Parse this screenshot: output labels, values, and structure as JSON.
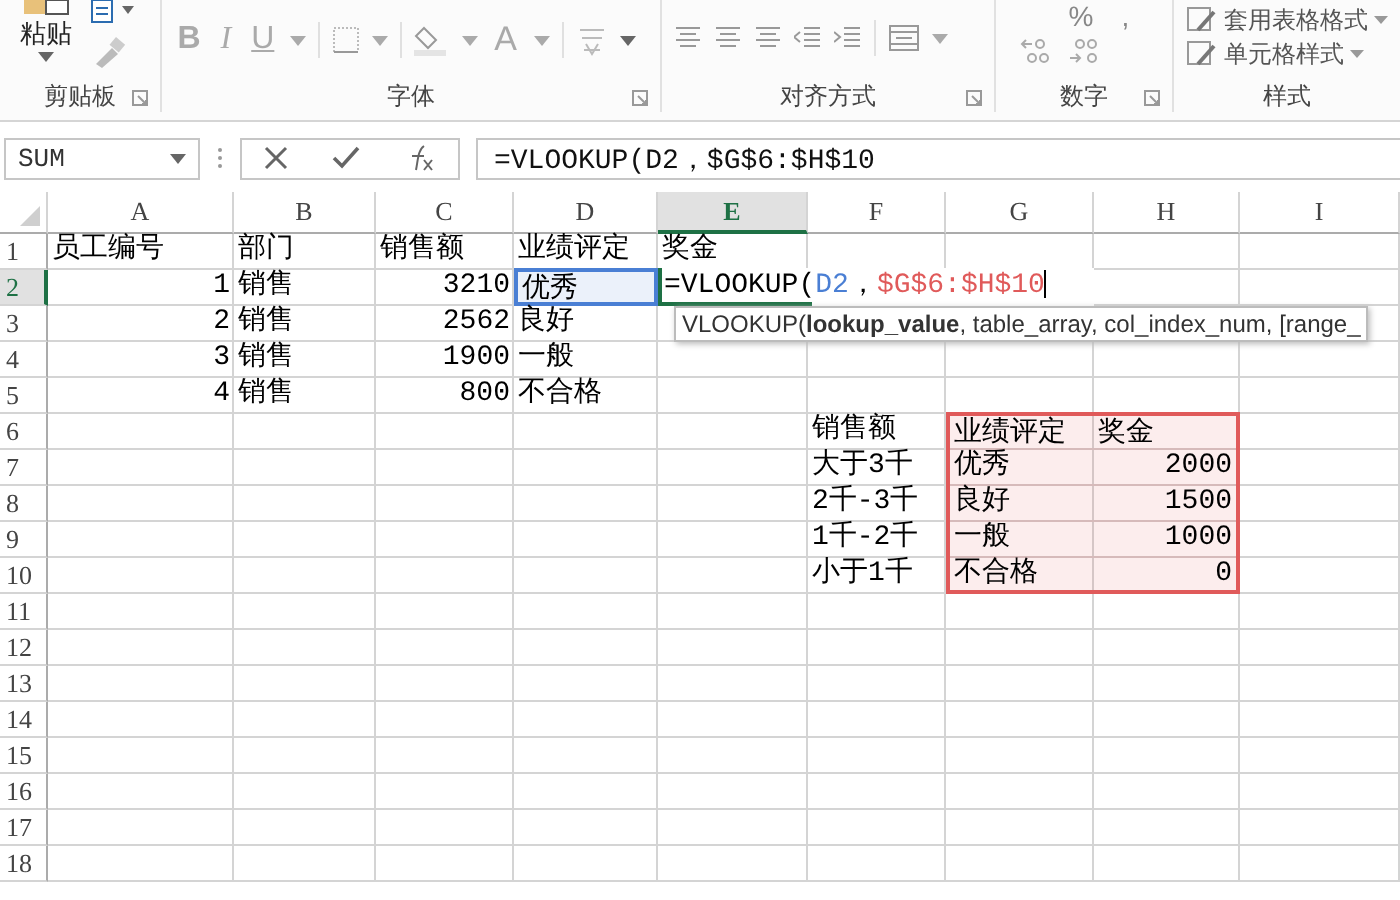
{
  "ribbon": {
    "groups": [
      {
        "kind": "clipboard",
        "label": "剪贴板",
        "launcher": true,
        "paste": "粘贴"
      },
      {
        "kind": "font",
        "label": "字体",
        "launcher": true,
        "buttons": [
          "B",
          "I",
          "U",
          "A"
        ]
      },
      {
        "kind": "alignment",
        "label": "对齐方式",
        "launcher": true
      },
      {
        "kind": "number",
        "label": "数字",
        "launcher": true,
        "buttons": [
          "%",
          ","
        ]
      },
      {
        "kind": "styles",
        "label": "样式",
        "launcher": false,
        "items": [
          "套用表格格式",
          "单元格样式"
        ]
      }
    ]
  },
  "formula_bar": {
    "name_box": "SUM",
    "formula": "=VLOOKUP(D2，$G$6:$H$10"
  },
  "columns": [
    {
      "label": "A",
      "selected": false
    },
    {
      "label": "B",
      "selected": false
    },
    {
      "label": "C",
      "selected": false
    },
    {
      "label": "D",
      "selected": false
    },
    {
      "label": "E",
      "selected": true
    },
    {
      "label": "F",
      "selected": false
    },
    {
      "label": "G",
      "selected": false
    },
    {
      "label": "H",
      "selected": false
    },
    {
      "label": "I",
      "selected": false
    }
  ],
  "rows": [
    {
      "label": "1",
      "selected": false,
      "cells": [
        {
          "kind": "text",
          "text": "员工编号"
        },
        {
          "kind": "text",
          "text": "部门"
        },
        {
          "kind": "text",
          "text": "销售额"
        },
        {
          "kind": "text",
          "text": "业绩评定"
        },
        {
          "kind": "text",
          "text": "奖金"
        }
      ]
    },
    {
      "label": "2",
      "selected": true,
      "cells": [
        {
          "kind": "number",
          "text": "1"
        },
        {
          "kind": "text",
          "text": "销售"
        },
        {
          "kind": "number",
          "text": "3210"
        },
        {
          "kind": "text",
          "text": "优秀",
          "color": "#4a7fd4"
        },
        {
          "kind": "edit",
          "parts": [
            {
              "text": "=VLOOKUP(",
              "color": "#000000"
            },
            {
              "text": "D2",
              "color": "#4a7fd4"
            },
            {
              "text": "，",
              "color": "#000000"
            },
            {
              "text": "$G$6:$H$10",
              "color": "#e05a5a"
            }
          ]
        }
      ]
    },
    {
      "label": "3",
      "selected": false,
      "cells": [
        {
          "kind": "number",
          "text": "2"
        },
        {
          "kind": "text",
          "text": "销售"
        },
        {
          "kind": "number",
          "text": "2562"
        },
        {
          "kind": "text",
          "text": "良好"
        }
      ]
    },
    {
      "label": "4",
      "selected": false,
      "cells": [
        {
          "kind": "number",
          "text": "3"
        },
        {
          "kind": "text",
          "text": "销售"
        },
        {
          "kind": "number",
          "text": "1900"
        },
        {
          "kind": "text",
          "text": "一般"
        }
      ]
    },
    {
      "label": "5",
      "selected": false,
      "cells": [
        {
          "kind": "number",
          "text": "4"
        },
        {
          "kind": "text",
          "text": "销售"
        },
        {
          "kind": "number",
          "text": "800"
        },
        {
          "kind": "text",
          "text": "不合格"
        }
      ]
    },
    {
      "label": "6",
      "selected": false,
      "cells": [
        {
          "kind": "blank"
        },
        {
          "kind": "blank"
        },
        {
          "kind": "blank"
        },
        {
          "kind": "blank"
        },
        {
          "kind": "blank"
        },
        {
          "kind": "text",
          "text": "销售额"
        },
        {
          "kind": "text",
          "text": "业绩评定",
          "color": "#e05a5a"
        },
        {
          "kind": "text",
          "text": "奖金",
          "color": "#e05a5a"
        }
      ]
    },
    {
      "label": "7",
      "selected": false,
      "cells": [
        {
          "kind": "blank"
        },
        {
          "kind": "blank"
        },
        {
          "kind": "blank"
        },
        {
          "kind": "blank"
        },
        {
          "kind": "blank"
        },
        {
          "kind": "text",
          "text": "大于3千"
        },
        {
          "kind": "text",
          "text": "优秀",
          "color": "#e05a5a"
        },
        {
          "kind": "number",
          "text": "2000",
          "color": "#e05a5a"
        }
      ]
    },
    {
      "label": "8",
      "selected": false,
      "cells": [
        {
          "kind": "blank"
        },
        {
          "kind": "blank"
        },
        {
          "kind": "blank"
        },
        {
          "kind": "blank"
        },
        {
          "kind": "blank"
        },
        {
          "kind": "text",
          "text": "2千-3千"
        },
        {
          "kind": "text",
          "text": "良好",
          "color": "#e05a5a"
        },
        {
          "kind": "number",
          "text": "1500",
          "color": "#e05a5a"
        }
      ]
    },
    {
      "label": "9",
      "selected": false,
      "cells": [
        {
          "kind": "blank"
        },
        {
          "kind": "blank"
        },
        {
          "kind": "blank"
        },
        {
          "kind": "blank"
        },
        {
          "kind": "blank"
        },
        {
          "kind": "text",
          "text": "1千-2千"
        },
        {
          "kind": "text",
          "text": "一般",
          "color": "#e05a5a"
        },
        {
          "kind": "number",
          "text": "1000",
          "color": "#e05a5a"
        }
      ]
    },
    {
      "label": "10",
      "selected": false,
      "cells": [
        {
          "kind": "blank"
        },
        {
          "kind": "blank"
        },
        {
          "kind": "blank"
        },
        {
          "kind": "blank"
        },
        {
          "kind": "blank"
        },
        {
          "kind": "text",
          "text": "小于1千"
        },
        {
          "kind": "text",
          "text": "不合格",
          "color": "#e05a5a"
        },
        {
          "kind": "number",
          "text": "0",
          "color": "#e05a5a"
        }
      ]
    },
    {
      "label": "11",
      "selected": false
    },
    {
      "label": "12",
      "selected": false
    },
    {
      "label": "13",
      "selected": false
    },
    {
      "label": "14",
      "selected": false
    },
    {
      "label": "15",
      "selected": false
    },
    {
      "label": "16",
      "selected": false
    },
    {
      "label": "17",
      "selected": false
    },
    {
      "label": "18",
      "selected": false
    }
  ],
  "tooltip": {
    "text": "VLOOKUP(**lookup_value**, table_array, col_index_num, [range_"
  }
}
